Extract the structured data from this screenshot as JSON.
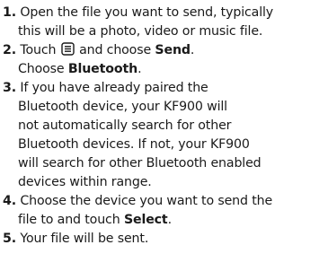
{
  "steps": [
    {
      "number": "1.",
      "lines": [
        "Open the file you want to send, typically",
        "this will be a photo, video or music file."
      ]
    },
    {
      "number": "2.",
      "touch_pre": "Touch",
      "menu_icon": "menu-icon",
      "touch_mid": "and choose",
      "send": "Send",
      "send_tail": ".",
      "choose_pre": "Choose",
      "bluetooth": "Bluetooth",
      "choose_tail": "."
    },
    {
      "number": "3.",
      "lines": [
        "If you have already paired the",
        "Bluetooth device, your KF900 will",
        "not automatically search for other",
        "Bluetooth devices. If not, your KF900",
        "will search for other Bluetooth enabled",
        "devices within range."
      ]
    },
    {
      "number": "4.",
      "line1": "Choose the device you want to send the",
      "line2_pre": "file to and touch",
      "select": "Select",
      "line2_tail": "."
    },
    {
      "number": "5.",
      "line1": "Your file will be sent."
    }
  ]
}
